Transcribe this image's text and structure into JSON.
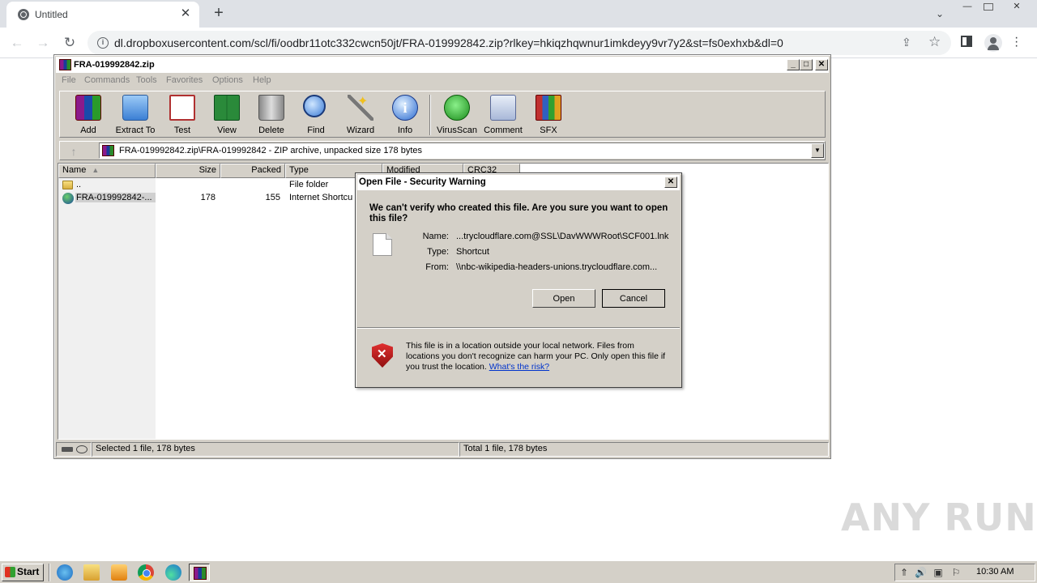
{
  "browser": {
    "tab_title": "Untitled",
    "tab_close": "✕",
    "new_tab": "+",
    "url": "dl.dropboxusercontent.com/scl/fi/oodbr11otc332cwcn50jt/FRA-019992842.zip?rlkey=hkiqzhqwnur1imkdeyy9vr7y2&st=fs0exhxb&dl=0"
  },
  "winrar": {
    "title": "FRA-019992842.zip",
    "menu": [
      "File",
      "Commands",
      "Tools",
      "Favorites",
      "Options",
      "Help"
    ],
    "toolbar": [
      "Add",
      "Extract To",
      "Test",
      "View",
      "Delete",
      "Find",
      "Wizard",
      "Info",
      "VirusScan",
      "Comment",
      "SFX"
    ],
    "address": "FRA-019992842.zip\\FRA-019992842 - ZIP archive, unpacked size 178 bytes",
    "columns": [
      "Name",
      "Size",
      "Packed",
      "Type",
      "Modified",
      "CRC32"
    ],
    "rows": [
      {
        "name": "..",
        "size": "",
        "packed": "",
        "type": "File folder"
      },
      {
        "name": "FRA-019992842-...",
        "size": "178",
        "packed": "155",
        "type": "Internet Shortcu"
      }
    ],
    "status_left": "Selected 1 file, 178 bytes",
    "status_right": "Total 1 file, 178 bytes"
  },
  "dialog": {
    "title": "Open File - Security Warning",
    "question": "We can't verify who created this file. Are you sure you want to open this file?",
    "name_label": "Name:",
    "name_value": "...trycloudflare.com@SSL\\DavWWWRoot\\SCF001.lnk",
    "type_label": "Type:",
    "type_value": "Shortcut",
    "from_label": "From:",
    "from_value": "\\\\nbc-wikipedia-headers-unions.trycloudflare.com...",
    "open_button": "Open",
    "cancel_button": "Cancel",
    "warning_text": "This file is in a location outside your local network. Files from locations you don't recognize can harm your PC. Only open this file if you trust the location.",
    "risk_link": "What's the risk?"
  },
  "watermark": "ANY RUN",
  "taskbar": {
    "start": "Start",
    "clock": "10:30 AM"
  }
}
